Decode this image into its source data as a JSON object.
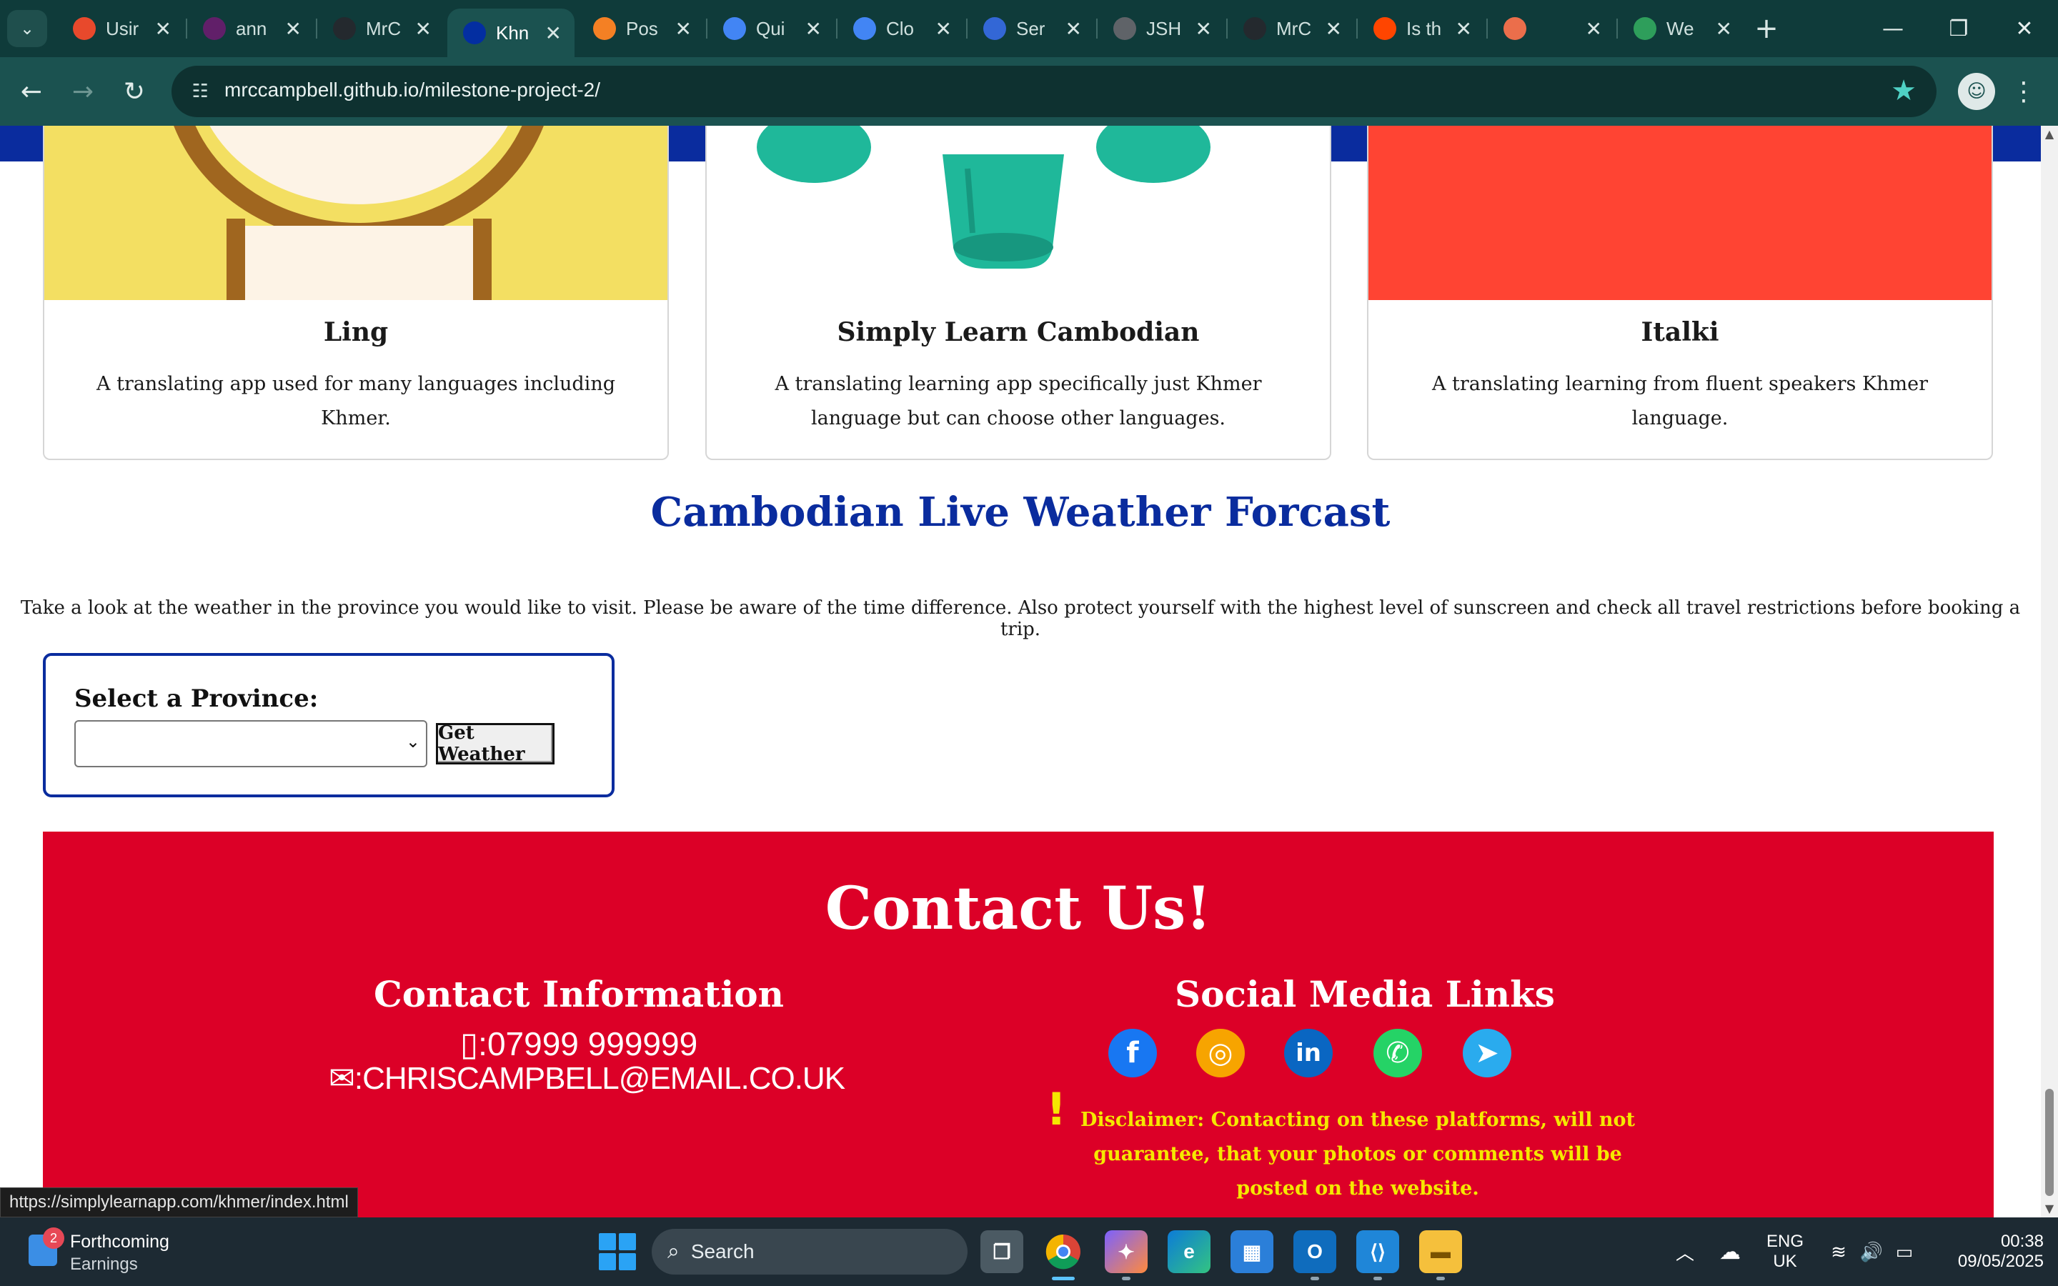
{
  "browser": {
    "tabs": [
      {
        "label": "Usir",
        "favicon": "red-ring",
        "color": "#e8492c",
        "active": false
      },
      {
        "label": "ann",
        "favicon": "slack",
        "color": "#611f69",
        "active": false
      },
      {
        "label": "MrC",
        "favicon": "github",
        "color": "#24292e",
        "active": false
      },
      {
        "label": "Khn",
        "favicon": "cambodia-flag",
        "color": "#032ea1",
        "active": true
      },
      {
        "label": "Pos",
        "favicon": "stackoverflow",
        "color": "#f48024",
        "active": false
      },
      {
        "label": "Qui",
        "favicon": "google-cloud",
        "color": "#4285f4",
        "active": false
      },
      {
        "label": "Clo",
        "favicon": "google-cloud",
        "color": "#4285f4",
        "active": false
      },
      {
        "label": "Ser",
        "favicon": "shield",
        "color": "#3367d6",
        "active": false
      },
      {
        "label": "JSH",
        "favicon": "globe",
        "color": "#5f6368",
        "active": false
      },
      {
        "label": "MrC",
        "favicon": "github",
        "color": "#24292e",
        "active": false
      },
      {
        "label": "Is th",
        "favicon": "reddit",
        "color": "#ff4500",
        "active": false
      },
      {
        "label": "",
        "favicon": "openweather",
        "color": "#eb6e4b",
        "active": false
      },
      {
        "label": "We",
        "favicon": "cube",
        "color": "#2e9e5b",
        "active": false
      }
    ],
    "url": "mrccampbell.github.io/milestone-project-2/",
    "status_url": "https://simplylearnapp.com/khmer/index.html"
  },
  "cards": [
    {
      "title": "Ling",
      "desc": "A translating app used for many languages including Khmer.",
      "image_bg": "#f3df62",
      "image": "ling-mascot"
    },
    {
      "title": "Simply Learn Cambodian",
      "desc": "A translating learning app specifically just Khmer language but can choose other languages.",
      "image_bg": "#ffffff",
      "image": "green-character"
    },
    {
      "title": "Italki",
      "desc": "A translating learning from fluent speakers Khmer language.",
      "image_bg": "#ff4433",
      "image": "italki-logo"
    }
  ],
  "weather": {
    "title": "Cambodian Live Weather Forcast",
    "text": "Take a look at the weather in the province you would like to visit. Please be aware of the time difference. Also protect yourself with the highest level of sunscreen and check all travel restrictions before booking a trip.",
    "select_label": "Select a Province:",
    "select_value": "",
    "button": "Get Weather"
  },
  "contact": {
    "title": "Contact Us!",
    "info_title": "Contact Information",
    "phone": ":07999 999999",
    "email": ":CHRISCAMPBELL@EMAIL.CO.UK",
    "social_title": "Social Media Links",
    "social": [
      {
        "name": "facebook",
        "glyph": "f",
        "color": "#1877f2"
      },
      {
        "name": "instagram",
        "glyph": "◎",
        "color": "#f7a400"
      },
      {
        "name": "linkedin",
        "glyph": "in",
        "color": "#0a66c2"
      },
      {
        "name": "whatsapp",
        "glyph": "✆",
        "color": "#25d366"
      },
      {
        "name": "telegram",
        "glyph": "➤",
        "color": "#2aabee"
      }
    ],
    "disclaimer_mark": "!",
    "disclaimer": "Disclaimer: Contacting on these platforms, will not guarantee, that your photos or comments will be posted on the website."
  },
  "taskbar": {
    "widget_badge": "2",
    "widget_line1": "Forthcoming",
    "widget_line2": "Earnings",
    "search": "Search",
    "lang1": "ENG",
    "lang2": "UK",
    "time": "00:38",
    "date": "09/05/2025"
  }
}
